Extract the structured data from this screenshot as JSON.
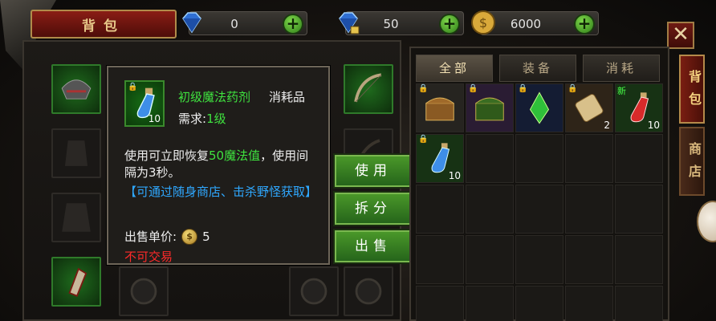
{
  "header": {
    "title": "背包",
    "resources": [
      {
        "name": "diamond",
        "icon": "blue-diamond-icon",
        "value": "0"
      },
      {
        "name": "bound-diamond",
        "icon": "locked-diamond-icon",
        "value": "50"
      },
      {
        "name": "gold",
        "icon": "gold-coin-icon",
        "value": "6000"
      }
    ],
    "plus": "+",
    "close": "✕"
  },
  "tooltip": {
    "item_name": "初级魔法药剂",
    "item_type": "消耗品",
    "item_count": "10",
    "req_label": "需求:",
    "req_value": "1级",
    "desc_1": "使用可立即恢复",
    "desc_value": "50魔法值",
    "desc_2": "，使用间隔为3秒。",
    "source": "【可通过随身商店、击杀野怪获取】",
    "price_label": "出售单价:",
    "price_value": "5",
    "coin_glyph": "$",
    "no_trade": "不可交易",
    "lock_glyph": "🔒"
  },
  "actions": {
    "use": "使用",
    "split": "拆分",
    "sell": "出售"
  },
  "bag": {
    "tabs": [
      "全部",
      "装备",
      "消耗"
    ],
    "items": [
      {
        "icon": "treasure-chest-icon",
        "locked": true,
        "count": ""
      },
      {
        "icon": "green-chest-icon",
        "locked": true,
        "count": ""
      },
      {
        "icon": "green-gem-icon",
        "locked": true,
        "count": ""
      },
      {
        "icon": "scroll-icon",
        "locked": true,
        "count": "2"
      },
      {
        "icon": "red-potion-icon",
        "new": "新",
        "count": "10"
      },
      {
        "icon": "blue-potion-icon",
        "locked": true,
        "count": "10"
      }
    ]
  },
  "side_tabs": [
    "背包",
    "商店"
  ],
  "colors": {
    "highlight_green": "#3fe23f",
    "link_blue": "#2fa8ff",
    "warning_red": "#ff2a2a"
  }
}
